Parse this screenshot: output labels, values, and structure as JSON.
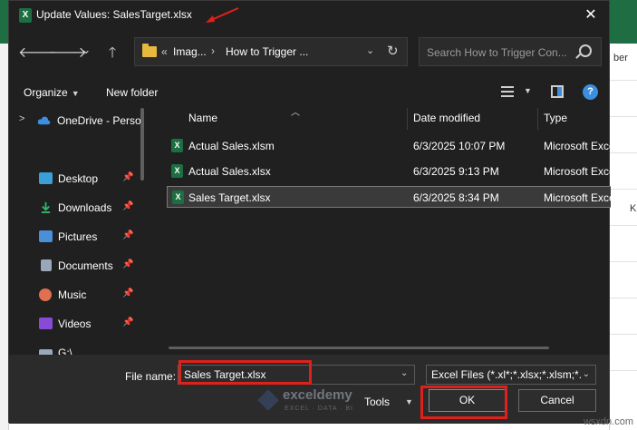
{
  "window": {
    "title": "Update Values: SalesTarget.xlsx",
    "app_icon": "excel-icon",
    "close_glyph": "✕"
  },
  "nav": {
    "back": "🡐",
    "forward": "🡒",
    "recent": "⌄",
    "up": "🡑",
    "breadcrumb": {
      "overflow": "«",
      "seg1": "Imag...",
      "seg2": "How to Trigger ..."
    },
    "search_placeholder": "Search How to Trigger Con..."
  },
  "commands": {
    "organize": "Organize",
    "new_folder": "New folder",
    "help": "?"
  },
  "sidebar": {
    "items": [
      {
        "label": "OneDrive - Perso",
        "icon": "cloud-icon",
        "color": "#3b8ee0",
        "pinned": false,
        "chevron": ">"
      },
      {
        "label": "Desktop",
        "icon": "desktop-icon",
        "color": "#3aa0d8",
        "pinned": true
      },
      {
        "label": "Downloads",
        "icon": "download-icon",
        "color": "#34b36b",
        "pinned": true
      },
      {
        "label": "Pictures",
        "icon": "pictures-icon",
        "color": "#4a8fd8",
        "pinned": true
      },
      {
        "label": "Documents",
        "icon": "documents-icon",
        "color": "#9aa7b8",
        "pinned": true
      },
      {
        "label": "Music",
        "icon": "music-icon",
        "color": "#e07050",
        "pinned": true
      },
      {
        "label": "Videos",
        "icon": "videos-icon",
        "color": "#8a4ad8",
        "pinned": true
      },
      {
        "label": "G:\\",
        "icon": "drive-icon",
        "color": "#9aa7b8",
        "pinned": false
      }
    ]
  },
  "files": {
    "columns": {
      "name": "Name",
      "date": "Date modified",
      "type": "Type"
    },
    "rows": [
      {
        "name": "Actual Sales.xlsm",
        "date": "6/3/2025 10:07 PM",
        "type": "Microsoft Excel M",
        "selected": false
      },
      {
        "name": "Actual Sales.xlsx",
        "date": "6/3/2025 9:13 PM",
        "type": "Microsoft Excel W",
        "selected": false
      },
      {
        "name": "Sales Target.xlsx",
        "date": "6/3/2025 8:34 PM",
        "type": "Microsoft Excel W",
        "selected": true
      }
    ]
  },
  "footer": {
    "filename_label": "File name:",
    "filename_value": "Sales Target.xlsx",
    "filter_value": "Excel Files (*.xl*;*.xlsx;*.xlsm;*.xl",
    "tools": "Tools",
    "ok": "OK",
    "cancel": "Cancel"
  },
  "watermark": {
    "name": "exceldemy",
    "tagline": "EXCEL · DATA · BI"
  },
  "credit": "wsxdn.com",
  "background": {
    "cells": [
      "ber",
      "K"
    ]
  },
  "colors": {
    "accent": "#3b8ee0",
    "highlight": "#e0201a",
    "excel_green": "#1d6f42"
  }
}
